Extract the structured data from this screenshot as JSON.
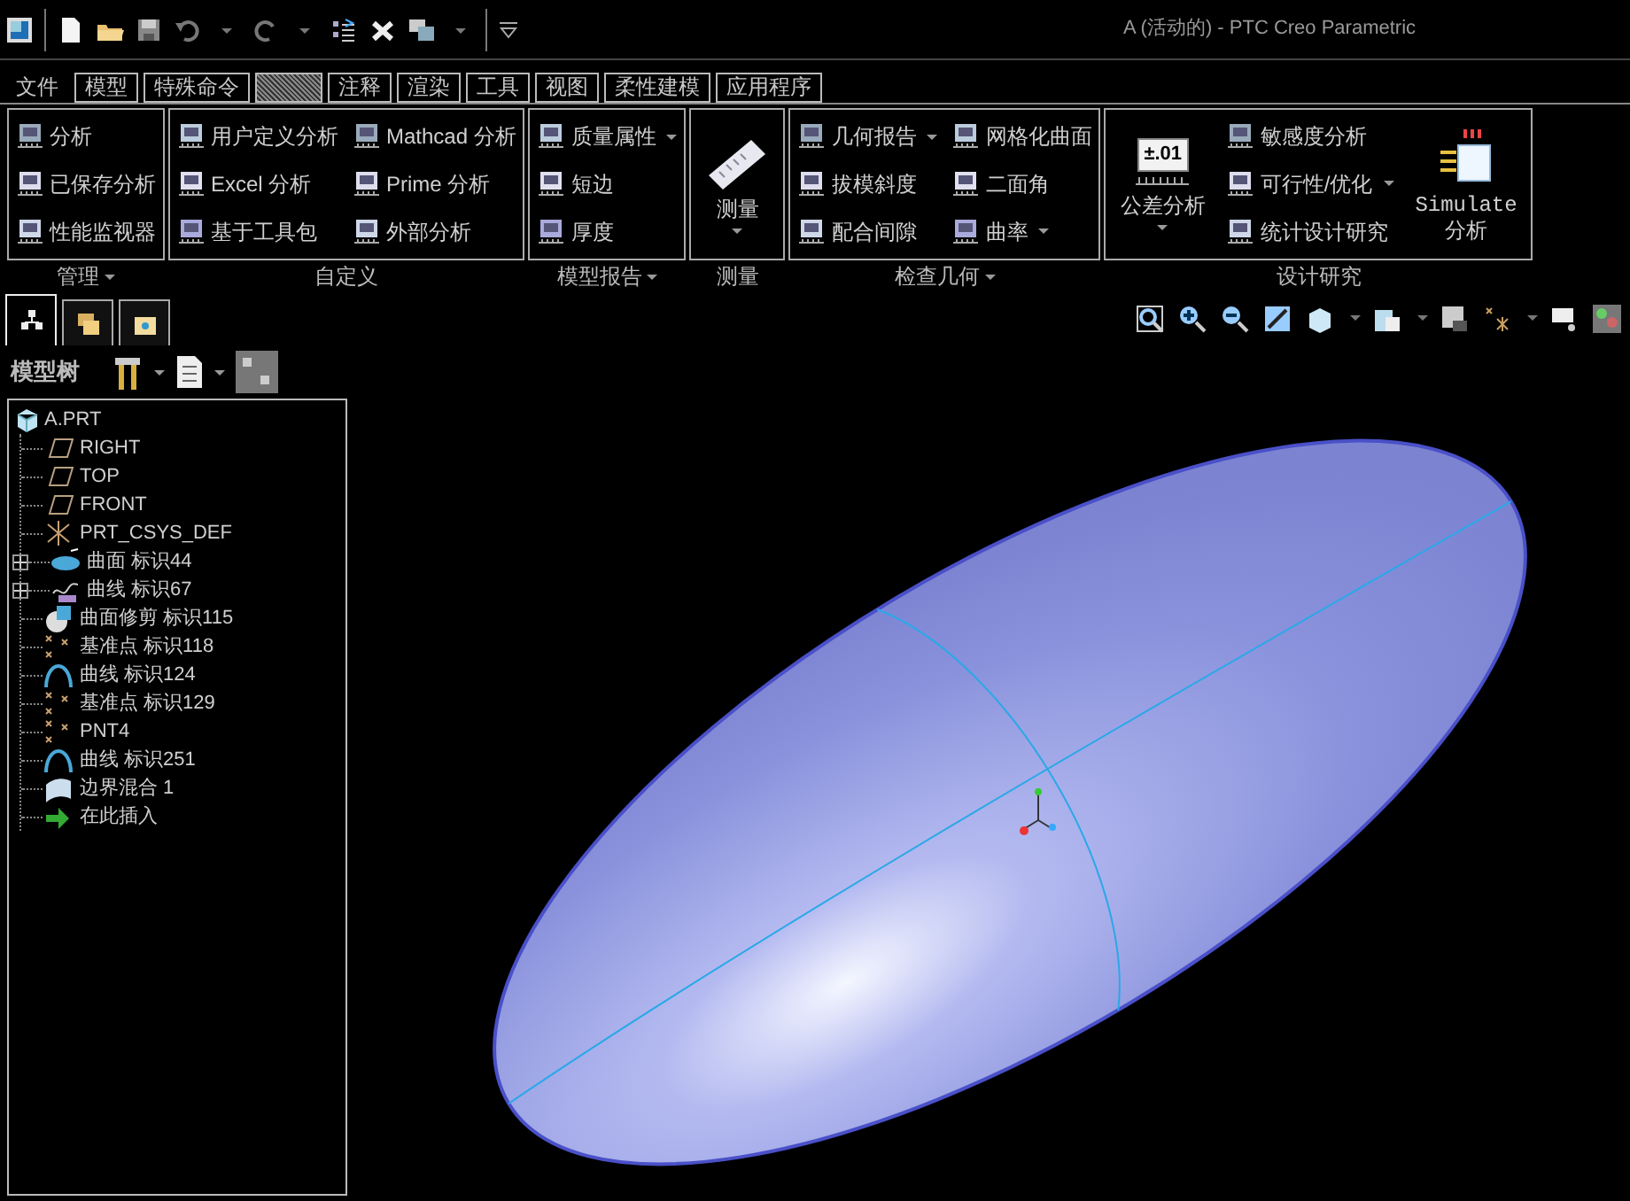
{
  "title_bar": {
    "title": "A (活动的) - PTC Creo Parametric"
  },
  "menu_tabs": [
    {
      "kind": "plain",
      "label": "文件",
      "selected": false
    },
    {
      "kind": "tab",
      "label": "模型",
      "selected": false
    },
    {
      "kind": "tab",
      "label": "特殊命令",
      "selected": false
    },
    {
      "kind": "tab",
      "selected": true
    },
    {
      "kind": "tab",
      "label": "注释",
      "selected": false
    },
    {
      "kind": "tab",
      "label": "渲染",
      "selected": false
    },
    {
      "kind": "tab",
      "label": "工具",
      "selected": false
    },
    {
      "kind": "tab",
      "label": "视图",
      "selected": false
    },
    {
      "kind": "tab",
      "label": "柔性建模",
      "selected": false
    },
    {
      "kind": "tab",
      "label": "应用程序",
      "selected": false
    }
  ],
  "ribbon": {
    "groups": [
      {
        "label": "管理",
        "dropdown": true,
        "columns": [
          [
            {
              "kind": "small",
              "label": "分析",
              "dropdown": false
            },
            {
              "kind": "small",
              "label": "已保存分析",
              "dropdown": false
            },
            {
              "kind": "small",
              "label": "性能监视器",
              "dropdown": false
            }
          ]
        ]
      },
      {
        "label": "自定义",
        "dropdown": false,
        "columns": [
          [
            {
              "kind": "small",
              "label": "用户定义分析",
              "dropdown": false
            },
            {
              "kind": "small",
              "label": "Excel 分析",
              "dropdown": false
            },
            {
              "kind": "small",
              "label": "基于工具包",
              "dropdown": false
            }
          ],
          [
            {
              "kind": "small",
              "label": "Mathcad 分析",
              "dropdown": false
            },
            {
              "kind": "small",
              "label": "Prime 分析",
              "dropdown": false
            },
            {
              "kind": "small",
              "label": "外部分析",
              "dropdown": false
            }
          ]
        ]
      },
      {
        "label": "模型报告",
        "dropdown": true,
        "columns": [
          [
            {
              "kind": "small",
              "label": "质量属性",
              "dropdown": true
            },
            {
              "kind": "small",
              "label": "短边",
              "dropdown": false
            },
            {
              "kind": "small",
              "label": "厚度",
              "dropdown": false
            }
          ]
        ]
      },
      {
        "label": "测量",
        "dropdown": false,
        "columns": [
          [
            {
              "kind": "large",
              "label": "测量",
              "dropdown": true
            }
          ]
        ]
      },
      {
        "label": "检查几何",
        "dropdown": true,
        "columns": [
          [
            {
              "kind": "small",
              "label": "几何报告",
              "dropdown": true
            },
            {
              "kind": "small",
              "label": "拔模斜度",
              "dropdown": false
            },
            {
              "kind": "small",
              "label": "配合间隙",
              "dropdown": false
            }
          ],
          [
            {
              "kind": "small",
              "label": "网格化曲面",
              "dropdown": false
            },
            {
              "kind": "small",
              "label": "二面角",
              "dropdown": false
            },
            {
              "kind": "small",
              "label": "曲率",
              "dropdown": true
            }
          ]
        ]
      },
      {
        "label": "设计研究",
        "dropdown": false,
        "columns": [
          [
            {
              "kind": "large",
              "badge": "±.01",
              "label": "公差分析",
              "dropdown": true
            }
          ],
          [
            {
              "kind": "small",
              "label": "敏感度分析",
              "dropdown": false
            },
            {
              "kind": "small",
              "label": "可行性/优化",
              "dropdown": true
            },
            {
              "kind": "small",
              "label": "统计设计研究",
              "dropdown": false
            }
          ],
          [
            {
              "kind": "large",
              "label_lines": [
                "Simulate",
                "分析"
              ],
              "dropdown": false
            }
          ]
        ]
      }
    ]
  },
  "panel_tabs": [
    {
      "selected": true
    },
    {
      "selected": false
    },
    {
      "selected": false
    }
  ],
  "model_tree": {
    "title": "模型树",
    "items": [
      {
        "label": "A.PRT",
        "children": [
          {
            "label": "RIGHT"
          },
          {
            "label": "TOP"
          },
          {
            "label": "FRONT"
          },
          {
            "label": "PRT_CSYS_DEF"
          },
          {
            "label": "曲面 标识44",
            "expanded": false
          },
          {
            "label": "曲线 标识67",
            "expanded": false
          },
          {
            "label": "曲面修剪 标识115"
          },
          {
            "label": "基准点 标识118"
          },
          {
            "label": "曲线 标识124"
          },
          {
            "label": "基准点 标识129"
          },
          {
            "label": "PNT4"
          },
          {
            "label": "曲线 标识251"
          },
          {
            "label": "边界混合 1"
          },
          {
            "label": "在此插入"
          }
        ]
      }
    ]
  }
}
